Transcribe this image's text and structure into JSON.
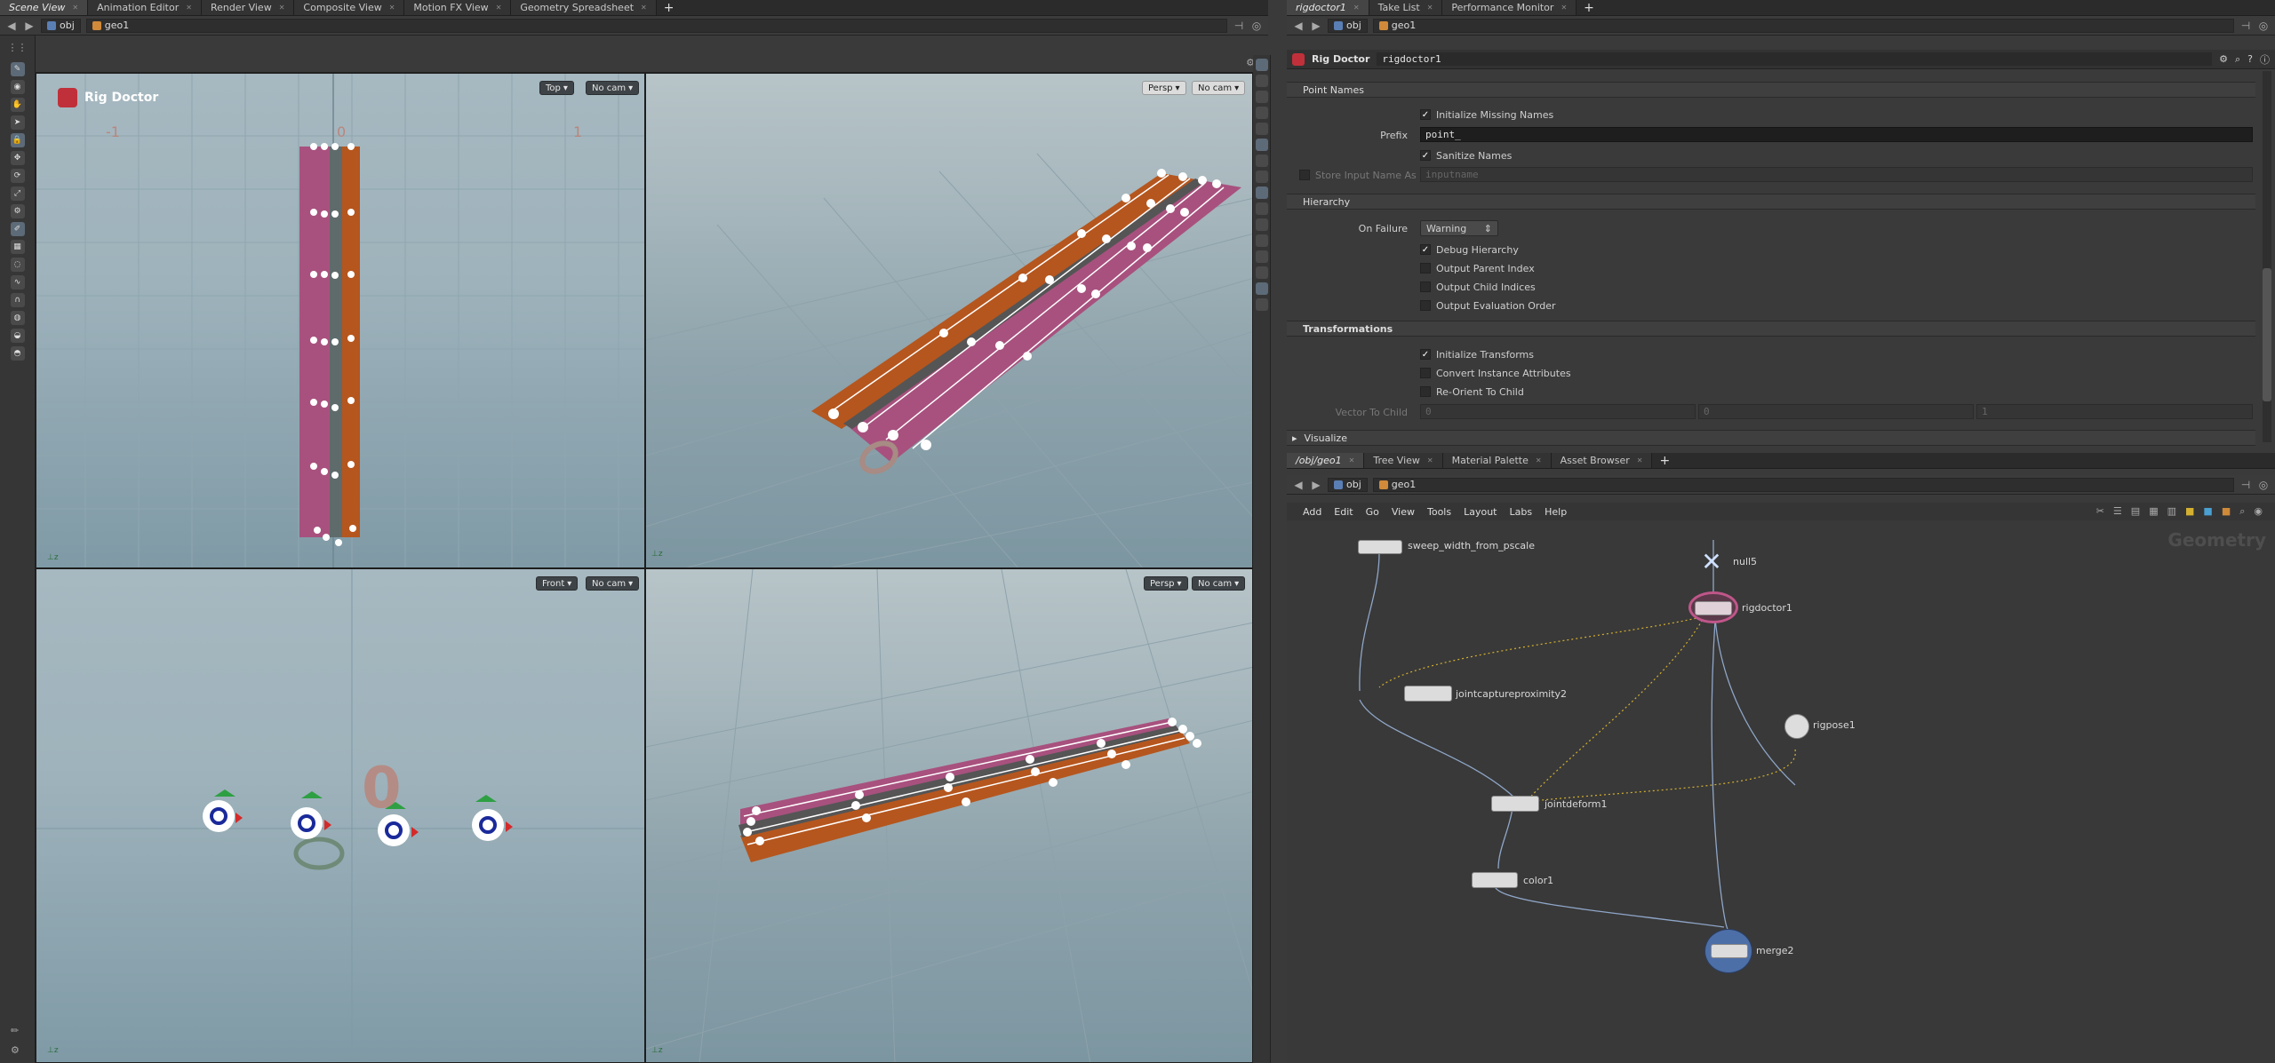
{
  "left_tabs": [
    {
      "label": "Scene View",
      "active": true
    },
    {
      "label": "Animation Editor",
      "active": false
    },
    {
      "label": "Render View",
      "active": false
    },
    {
      "label": "Composite View",
      "active": false
    },
    {
      "label": "Motion FX View",
      "active": false
    },
    {
      "label": "Geometry Spreadsheet",
      "active": false
    }
  ],
  "right_tabs": [
    {
      "label": "rigdoctor1",
      "active": true
    },
    {
      "label": "Take List",
      "active": false
    },
    {
      "label": "Performance Monitor",
      "active": false
    }
  ],
  "left_path": {
    "obj": "obj",
    "geo": "geo1"
  },
  "right_path": {
    "obj": "obj",
    "geo": "geo1"
  },
  "viewport": {
    "title": "Rig Doctor",
    "top_left": {
      "view": "Top",
      "cam": "No cam"
    },
    "top_right": {
      "view": "Persp",
      "cam": "No cam"
    },
    "bottom_left": {
      "view": "Front",
      "cam": "No cam"
    },
    "bottom_right": {
      "view": "Persp",
      "cam": "No cam"
    },
    "grid_labels": {
      "minus1": "-1",
      "zero": "0",
      "one": "1"
    },
    "big_zero": "0"
  },
  "params": {
    "node_type": "Rig Doctor",
    "node_name": "rigdoctor1",
    "section_point_names": "Point Names",
    "init_missing_names": "Initialize Missing Names",
    "prefix_label": "Prefix",
    "prefix_value": "point_",
    "sanitize_names": "Sanitize Names",
    "store_input_name_as": "Store Input Name As",
    "store_input_placeholder": "inputname",
    "section_hierarchy": "Hierarchy",
    "on_failure_label": "On Failure",
    "on_failure_value": "Warning",
    "debug_hierarchy": "Debug Hierarchy",
    "output_parent_index": "Output Parent Index",
    "output_child_indices": "Output Child Indices",
    "output_eval_order": "Output Evaluation Order",
    "section_transformations": "Transformations",
    "initialize_transforms": "Initialize Transforms",
    "convert_instance_attrs": "Convert Instance Attributes",
    "reorient_to_child": "Re-Orient To Child",
    "vector_to_child_label": "Vector To Child",
    "vector_values": [
      "0",
      "0",
      "1"
    ],
    "section_visualize": "Visualize"
  },
  "net_tabs": [
    {
      "label": "/obj/geo1",
      "active": true
    },
    {
      "label": "Tree View",
      "active": false
    },
    {
      "label": "Material Palette",
      "active": false
    },
    {
      "label": "Asset Browser",
      "active": false
    }
  ],
  "net_menu": [
    "Add",
    "Edit",
    "Go",
    "View",
    "Tools",
    "Layout",
    "Labs",
    "Help"
  ],
  "net_context": "Geometry",
  "nodes": {
    "sweep": "sweep_width_from_pscale",
    "null": "null5",
    "rigdoctor": "rigdoctor1",
    "jointcapture": "jointcaptureproximity2",
    "rigpose": "rigpose1",
    "jointdeform": "jointdeform1",
    "color": "color1",
    "merge": "merge2"
  },
  "colors": {
    "accent": "#4d6fa8",
    "orange": "#b5561e",
    "magenta": "#a84a7c",
    "selected_node": "#c0568a"
  }
}
